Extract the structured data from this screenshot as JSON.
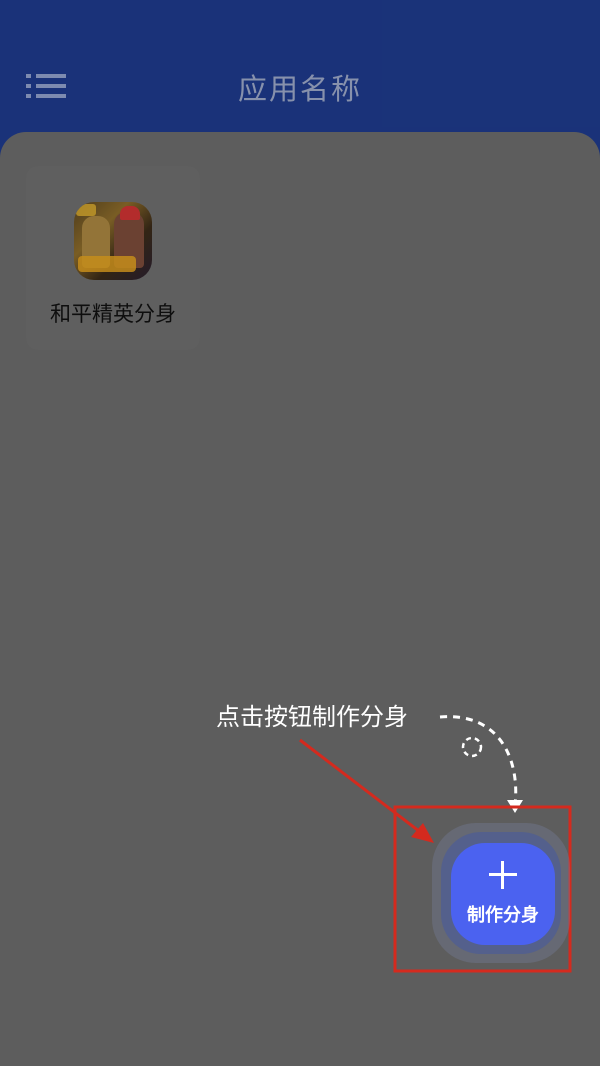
{
  "header": {
    "title": "应用名称",
    "menu_icon": "hamburger-menu-icon",
    "bg_color": "#1e3a8a"
  },
  "apps": [
    {
      "label": "和平精英分身",
      "icon": "game-app-icon"
    }
  ],
  "hint": {
    "text": "点击按钮制作分身",
    "arrow_color": "#d42a1e"
  },
  "fab": {
    "icon": "plus-icon",
    "label": "制作分身",
    "color": "#4b62f0"
  }
}
